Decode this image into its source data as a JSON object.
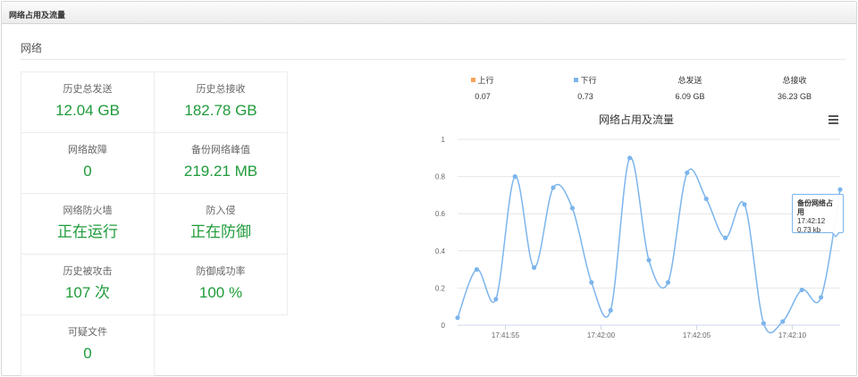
{
  "window": {
    "title": "网络占用及流量"
  },
  "section": {
    "title": "网络"
  },
  "stats": [
    {
      "label": "历史总发送",
      "value": "12.04 GB"
    },
    {
      "label": "历史总接收",
      "value": "182.78 GB"
    },
    {
      "label": "网络故障",
      "value": "0"
    },
    {
      "label": "备份网络峰值",
      "value": "219.21 MB"
    },
    {
      "label": "网络防火墙",
      "value": "正在运行"
    },
    {
      "label": "防入侵",
      "value": "正在防御"
    },
    {
      "label": "历史被攻击",
      "value": "107 次"
    },
    {
      "label": "防御成功率",
      "value": "100 %"
    },
    {
      "label": "可疑文件",
      "value": "0"
    }
  ],
  "summary": {
    "upload": {
      "label": "上行",
      "value": "0.07",
      "color": "#f7a35c"
    },
    "download": {
      "label": "下行",
      "value": "0.73",
      "color": "#7cb5ec"
    },
    "total_send": {
      "label": "总发送",
      "value": "6.09 GB"
    },
    "total_recv": {
      "label": "总接收",
      "value": "36.23 GB"
    }
  },
  "colors": {
    "accent_green": "#1f9b3a",
    "series_blue": "#7cb5ec"
  },
  "icons": {
    "menu": "hamburger-menu-icon"
  },
  "tooltip": {
    "title": "备份网络占用",
    "time": "17:42:12",
    "value": "0.73 kb"
  },
  "chart_data": {
    "type": "line",
    "title": "网络占用及流量",
    "ylim": [
      0,
      1
    ],
    "yticks": [
      0,
      0.2,
      0.4,
      0.6,
      0.8,
      1
    ],
    "ytick_labels": [
      "0",
      "0.2",
      "0.4",
      "0.6",
      "0.8",
      "1"
    ],
    "x_tick_labels": [
      "17:41:55",
      "17:42:00",
      "17:42:05",
      "17:42:10"
    ],
    "x_tick_index": [
      2.5,
      7.5,
      12.5,
      17.5
    ],
    "grid": true,
    "series": [
      {
        "values": [
          0.04,
          0.3,
          0.14,
          0.8,
          0.31,
          0.74,
          0.63,
          0.23,
          0.08,
          0.9,
          0.35,
          0.23,
          0.82,
          0.68,
          0.47,
          0.65,
          0.01,
          0.02,
          0.19,
          0.15,
          0.73
        ],
        "color": "#7cb5ec"
      }
    ]
  }
}
